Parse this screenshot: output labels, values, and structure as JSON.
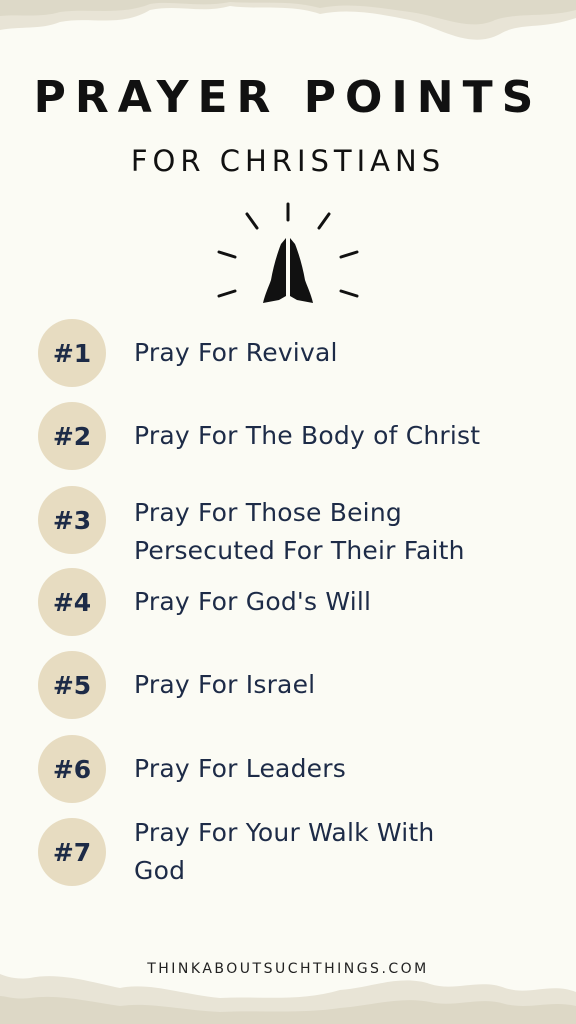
{
  "title": "PRAYER POINTS",
  "subtitle": "FOR CHRISTIANS",
  "icon": "praying-hands-icon",
  "colors": {
    "background": "#fbfbf4",
    "badge": "#e7dcc1",
    "text_navy": "#1d2b47",
    "title": "#111111"
  },
  "items": [
    {
      "number": "#1",
      "text": "Pray For Revival"
    },
    {
      "number": "#2",
      "text": "Pray For The Body of Christ"
    },
    {
      "number": "#3",
      "text_lines": [
        "Pray For Those Being",
        "Persecuted For Their Faith"
      ]
    },
    {
      "number": "#4",
      "text": "Pray For God's Will"
    },
    {
      "number": "#5",
      "text": "Pray For Israel"
    },
    {
      "number": "#6",
      "text": "Pray For Leaders"
    },
    {
      "number": "#7",
      "text_lines": [
        "Pray For Your Walk With",
        "God"
      ]
    }
  ],
  "footer": "THINKABOUTSUCHTHINGS.COM"
}
